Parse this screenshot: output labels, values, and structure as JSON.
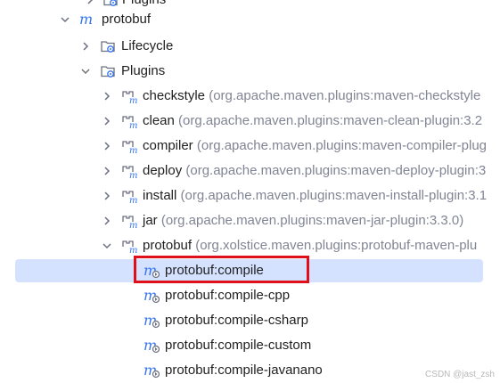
{
  "tree": {
    "rows": [
      {
        "label": "Plugins",
        "detail": ""
      },
      {
        "label": "protobuf",
        "detail": ""
      },
      {
        "label": "Lifecycle",
        "detail": ""
      },
      {
        "label": "Plugins",
        "detail": ""
      },
      {
        "label": "checkstyle",
        "detail": "(org.apache.maven.plugins:maven-checkstyle"
      },
      {
        "label": "clean",
        "detail": "(org.apache.maven.plugins:maven-clean-plugin:3.2"
      },
      {
        "label": "compiler",
        "detail": "(org.apache.maven.plugins:maven-compiler-plug"
      },
      {
        "label": "deploy",
        "detail": "(org.apache.maven.plugins:maven-deploy-plugin:3"
      },
      {
        "label": "install",
        "detail": "(org.apache.maven.plugins:maven-install-plugin:3.1"
      },
      {
        "label": "jar",
        "detail": "(org.apache.maven.plugins:maven-jar-plugin:3.3.0)"
      },
      {
        "label": "protobuf",
        "detail": "(org.xolstice.maven.plugins:protobuf-maven-plu"
      },
      {
        "label": "protobuf:compile",
        "detail": ""
      },
      {
        "label": "protobuf:compile-cpp",
        "detail": ""
      },
      {
        "label": "protobuf:compile-csharp",
        "detail": ""
      },
      {
        "label": "protobuf:compile-custom",
        "detail": ""
      },
      {
        "label": "protobuf:compile-javanano",
        "detail": ""
      }
    ]
  },
  "watermark": "CSDN @jast_zsh",
  "colors": {
    "selection": "#d4e2ff",
    "highlight_border": "#e0101a",
    "maven_icon": "#3574f0",
    "detail_text": "#818594"
  }
}
